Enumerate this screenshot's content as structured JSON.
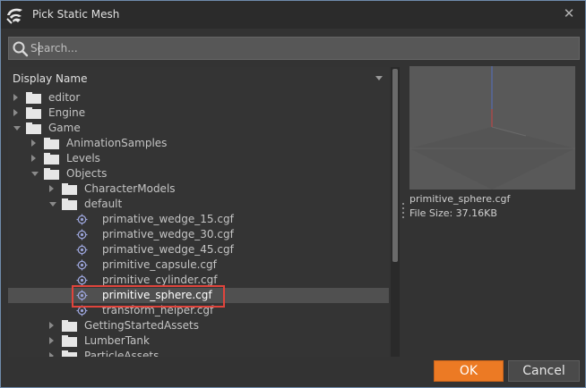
{
  "window": {
    "title": "Pick Static Mesh",
    "close_icon": "close-icon"
  },
  "search": {
    "placeholder": "Search...",
    "value": ""
  },
  "tree": {
    "header": "Display Name",
    "rows": [
      {
        "label": "editor",
        "type": "folder",
        "depth": 0,
        "state": "collapsed"
      },
      {
        "label": "Engine",
        "type": "folder",
        "depth": 0,
        "state": "collapsed"
      },
      {
        "label": "Game",
        "type": "folder",
        "depth": 0,
        "state": "expanded"
      },
      {
        "label": "AnimationSamples",
        "type": "folder",
        "depth": 1,
        "state": "collapsed"
      },
      {
        "label": "Levels",
        "type": "folder",
        "depth": 1,
        "state": "collapsed"
      },
      {
        "label": "Objects",
        "type": "folder",
        "depth": 1,
        "state": "expanded"
      },
      {
        "label": "CharacterModels",
        "type": "folder",
        "depth": 2,
        "state": "collapsed"
      },
      {
        "label": "default",
        "type": "folder",
        "depth": 2,
        "state": "expanded"
      },
      {
        "label": "primative_wedge_15.cgf",
        "type": "mesh",
        "depth": 3
      },
      {
        "label": "primative_wedge_30.cgf",
        "type": "mesh",
        "depth": 3
      },
      {
        "label": "primative_wedge_45.cgf",
        "type": "mesh",
        "depth": 3
      },
      {
        "label": "primitive_capsule.cgf",
        "type": "mesh",
        "depth": 3
      },
      {
        "label": "primitive_cylinder.cgf",
        "type": "mesh",
        "depth": 3
      },
      {
        "label": "primitive_sphere.cgf",
        "type": "mesh",
        "depth": 3,
        "selected": true
      },
      {
        "label": "transform_helper.cgf",
        "type": "mesh",
        "depth": 3
      },
      {
        "label": "GettingStartedAssets",
        "type": "folder",
        "depth": 2,
        "state": "collapsed"
      },
      {
        "label": "LumberTank",
        "type": "folder",
        "depth": 2,
        "state": "collapsed"
      },
      {
        "label": "ParticleAssets",
        "type": "folder",
        "depth": 2,
        "state": "collapsed"
      }
    ]
  },
  "preview": {
    "file_name": "primitive_sphere.cgf",
    "file_size": "File Size: 37.16KB"
  },
  "buttons": {
    "ok": "OK",
    "cancel": "Cancel"
  },
  "colors": {
    "accent": "#ec7a24",
    "selection_outline": "#e0443c",
    "selected_row": "#505050"
  }
}
